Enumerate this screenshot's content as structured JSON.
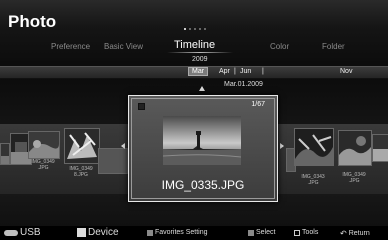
{
  "app": {
    "title": "Photo"
  },
  "tabs": [
    {
      "label": "Preference",
      "active": false
    },
    {
      "label": "Basic View",
      "active": false
    },
    {
      "label": "Timeline",
      "active": true
    },
    {
      "label": "Color",
      "active": false
    },
    {
      "label": "Folder",
      "active": false
    }
  ],
  "timeline": {
    "year": "2009",
    "months": [
      "Mar",
      "Apr",
      "Jun",
      "Nov"
    ],
    "selected_month": "Mar",
    "date_label": "Mar.01.2009"
  },
  "focused_photo": {
    "counter": "1/67",
    "filename": "IMG_0335.JPG"
  },
  "thumbnails": {
    "left_captions": [
      "IMG_0349\n.JPG",
      "IMG_0349\n8.JPG"
    ],
    "right_captions": [
      "IMG_0343\n.JPG",
      "IMG_0349\n.JPG"
    ]
  },
  "bottom_bar": {
    "usb_label": "USB",
    "device_label": "Device",
    "favorites_label": "Favorites Setting",
    "select_label": "Select",
    "tools_label": "Tools",
    "return_label": "Return"
  },
  "colors": {
    "usb_icon": "#bfbfbf",
    "device_square": "#dddddd",
    "favorites_square": "#8a8a8a",
    "select_square": "#8a8a8a"
  }
}
